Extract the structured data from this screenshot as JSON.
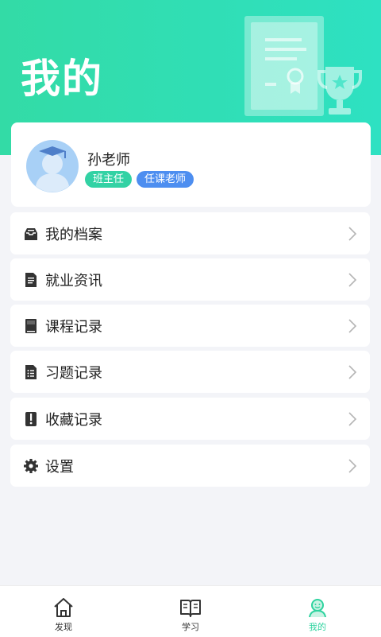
{
  "header": {
    "title": "我的"
  },
  "profile": {
    "name": "孙老师",
    "tags": [
      "班主任",
      "任课老师"
    ]
  },
  "menu": [
    {
      "label": "我的档案",
      "icon": "archive-box-icon"
    },
    {
      "label": "就业资讯",
      "icon": "document-icon"
    },
    {
      "label": "课程记录",
      "icon": "book-icon"
    },
    {
      "label": "习题记录",
      "icon": "list-document-icon"
    },
    {
      "label": "收藏记录",
      "icon": "bookmark-icon"
    },
    {
      "label": "设置",
      "icon": "gear-icon"
    }
  ],
  "tabbar": {
    "tabs": [
      {
        "label": "发现",
        "icon": "home-icon"
      },
      {
        "label": "学习",
        "icon": "open-book-icon"
      },
      {
        "label": "我的",
        "icon": "user-icon"
      }
    ],
    "active_index": 2
  },
  "colors": {
    "header_start": "#33dba6",
    "header_end": "#2ee1c2",
    "accent_green": "#2fd39f",
    "tag_blue": "#4d8ef0",
    "background": "#f3f4f8"
  }
}
